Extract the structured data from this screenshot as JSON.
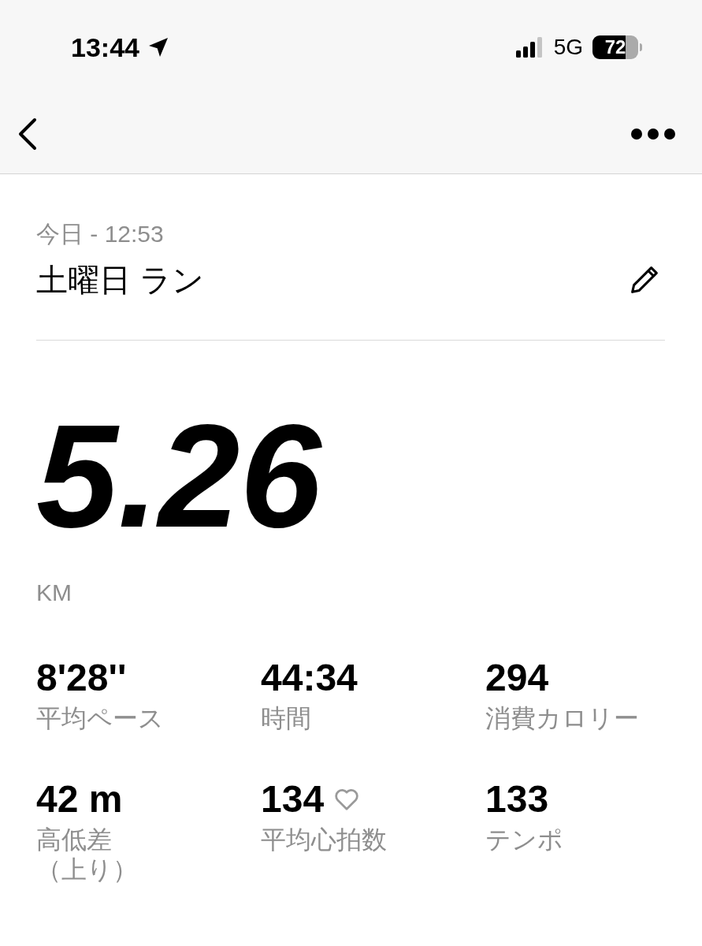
{
  "status_bar": {
    "time": "13:44",
    "network": "5G",
    "battery": "72"
  },
  "activity": {
    "date": "今日 - 12:53",
    "title": "土曜日 ラン",
    "distance": "5.26",
    "unit": "KM"
  },
  "stats": [
    {
      "kind": "plain",
      "value": "8'28''",
      "label": "平均ペース"
    },
    {
      "kind": "plain",
      "value": "44:34",
      "label": "時間"
    },
    {
      "kind": "plain",
      "value": "294",
      "label": "消費カロリー"
    },
    {
      "kind": "plain",
      "value": "42 m",
      "label": "高低差",
      "sublabel": "（上り）"
    },
    {
      "kind": "heart",
      "value": "134",
      "label": "平均心拍数"
    },
    {
      "kind": "plain",
      "value": "133",
      "label": "テンポ"
    }
  ]
}
